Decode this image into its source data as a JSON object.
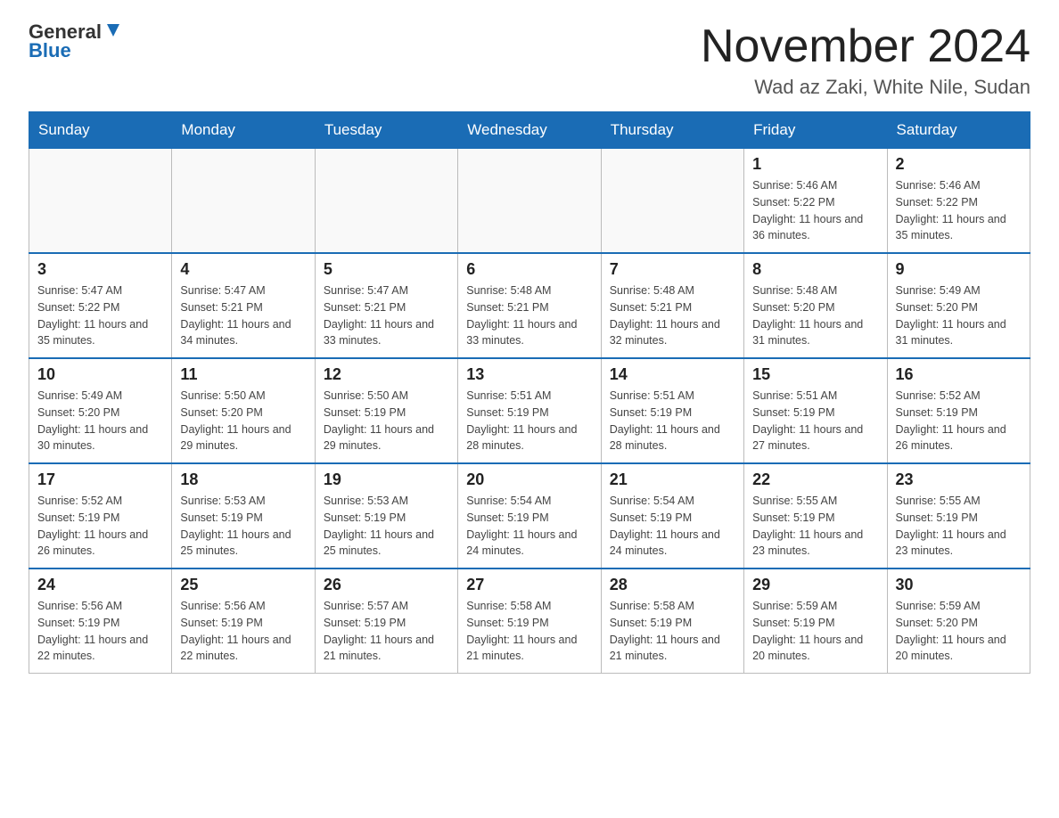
{
  "logo": {
    "line1": "General",
    "line2": "Blue"
  },
  "header": {
    "title": "November 2024",
    "subtitle": "Wad az Zaki, White Nile, Sudan"
  },
  "days_of_week": [
    "Sunday",
    "Monday",
    "Tuesday",
    "Wednesday",
    "Thursday",
    "Friday",
    "Saturday"
  ],
  "weeks": [
    [
      {
        "day": "",
        "detail": ""
      },
      {
        "day": "",
        "detail": ""
      },
      {
        "day": "",
        "detail": ""
      },
      {
        "day": "",
        "detail": ""
      },
      {
        "day": "",
        "detail": ""
      },
      {
        "day": "1",
        "detail": "Sunrise: 5:46 AM\nSunset: 5:22 PM\nDaylight: 11 hours and 36 minutes."
      },
      {
        "day": "2",
        "detail": "Sunrise: 5:46 AM\nSunset: 5:22 PM\nDaylight: 11 hours and 35 minutes."
      }
    ],
    [
      {
        "day": "3",
        "detail": "Sunrise: 5:47 AM\nSunset: 5:22 PM\nDaylight: 11 hours and 35 minutes."
      },
      {
        "day": "4",
        "detail": "Sunrise: 5:47 AM\nSunset: 5:21 PM\nDaylight: 11 hours and 34 minutes."
      },
      {
        "day": "5",
        "detail": "Sunrise: 5:47 AM\nSunset: 5:21 PM\nDaylight: 11 hours and 33 minutes."
      },
      {
        "day": "6",
        "detail": "Sunrise: 5:48 AM\nSunset: 5:21 PM\nDaylight: 11 hours and 33 minutes."
      },
      {
        "day": "7",
        "detail": "Sunrise: 5:48 AM\nSunset: 5:21 PM\nDaylight: 11 hours and 32 minutes."
      },
      {
        "day": "8",
        "detail": "Sunrise: 5:48 AM\nSunset: 5:20 PM\nDaylight: 11 hours and 31 minutes."
      },
      {
        "day": "9",
        "detail": "Sunrise: 5:49 AM\nSunset: 5:20 PM\nDaylight: 11 hours and 31 minutes."
      }
    ],
    [
      {
        "day": "10",
        "detail": "Sunrise: 5:49 AM\nSunset: 5:20 PM\nDaylight: 11 hours and 30 minutes."
      },
      {
        "day": "11",
        "detail": "Sunrise: 5:50 AM\nSunset: 5:20 PM\nDaylight: 11 hours and 29 minutes."
      },
      {
        "day": "12",
        "detail": "Sunrise: 5:50 AM\nSunset: 5:19 PM\nDaylight: 11 hours and 29 minutes."
      },
      {
        "day": "13",
        "detail": "Sunrise: 5:51 AM\nSunset: 5:19 PM\nDaylight: 11 hours and 28 minutes."
      },
      {
        "day": "14",
        "detail": "Sunrise: 5:51 AM\nSunset: 5:19 PM\nDaylight: 11 hours and 28 minutes."
      },
      {
        "day": "15",
        "detail": "Sunrise: 5:51 AM\nSunset: 5:19 PM\nDaylight: 11 hours and 27 minutes."
      },
      {
        "day": "16",
        "detail": "Sunrise: 5:52 AM\nSunset: 5:19 PM\nDaylight: 11 hours and 26 minutes."
      }
    ],
    [
      {
        "day": "17",
        "detail": "Sunrise: 5:52 AM\nSunset: 5:19 PM\nDaylight: 11 hours and 26 minutes."
      },
      {
        "day": "18",
        "detail": "Sunrise: 5:53 AM\nSunset: 5:19 PM\nDaylight: 11 hours and 25 minutes."
      },
      {
        "day": "19",
        "detail": "Sunrise: 5:53 AM\nSunset: 5:19 PM\nDaylight: 11 hours and 25 minutes."
      },
      {
        "day": "20",
        "detail": "Sunrise: 5:54 AM\nSunset: 5:19 PM\nDaylight: 11 hours and 24 minutes."
      },
      {
        "day": "21",
        "detail": "Sunrise: 5:54 AM\nSunset: 5:19 PM\nDaylight: 11 hours and 24 minutes."
      },
      {
        "day": "22",
        "detail": "Sunrise: 5:55 AM\nSunset: 5:19 PM\nDaylight: 11 hours and 23 minutes."
      },
      {
        "day": "23",
        "detail": "Sunrise: 5:55 AM\nSunset: 5:19 PM\nDaylight: 11 hours and 23 minutes."
      }
    ],
    [
      {
        "day": "24",
        "detail": "Sunrise: 5:56 AM\nSunset: 5:19 PM\nDaylight: 11 hours and 22 minutes."
      },
      {
        "day": "25",
        "detail": "Sunrise: 5:56 AM\nSunset: 5:19 PM\nDaylight: 11 hours and 22 minutes."
      },
      {
        "day": "26",
        "detail": "Sunrise: 5:57 AM\nSunset: 5:19 PM\nDaylight: 11 hours and 21 minutes."
      },
      {
        "day": "27",
        "detail": "Sunrise: 5:58 AM\nSunset: 5:19 PM\nDaylight: 11 hours and 21 minutes."
      },
      {
        "day": "28",
        "detail": "Sunrise: 5:58 AM\nSunset: 5:19 PM\nDaylight: 11 hours and 21 minutes."
      },
      {
        "day": "29",
        "detail": "Sunrise: 5:59 AM\nSunset: 5:19 PM\nDaylight: 11 hours and 20 minutes."
      },
      {
        "day": "30",
        "detail": "Sunrise: 5:59 AM\nSunset: 5:20 PM\nDaylight: 11 hours and 20 minutes."
      }
    ]
  ]
}
